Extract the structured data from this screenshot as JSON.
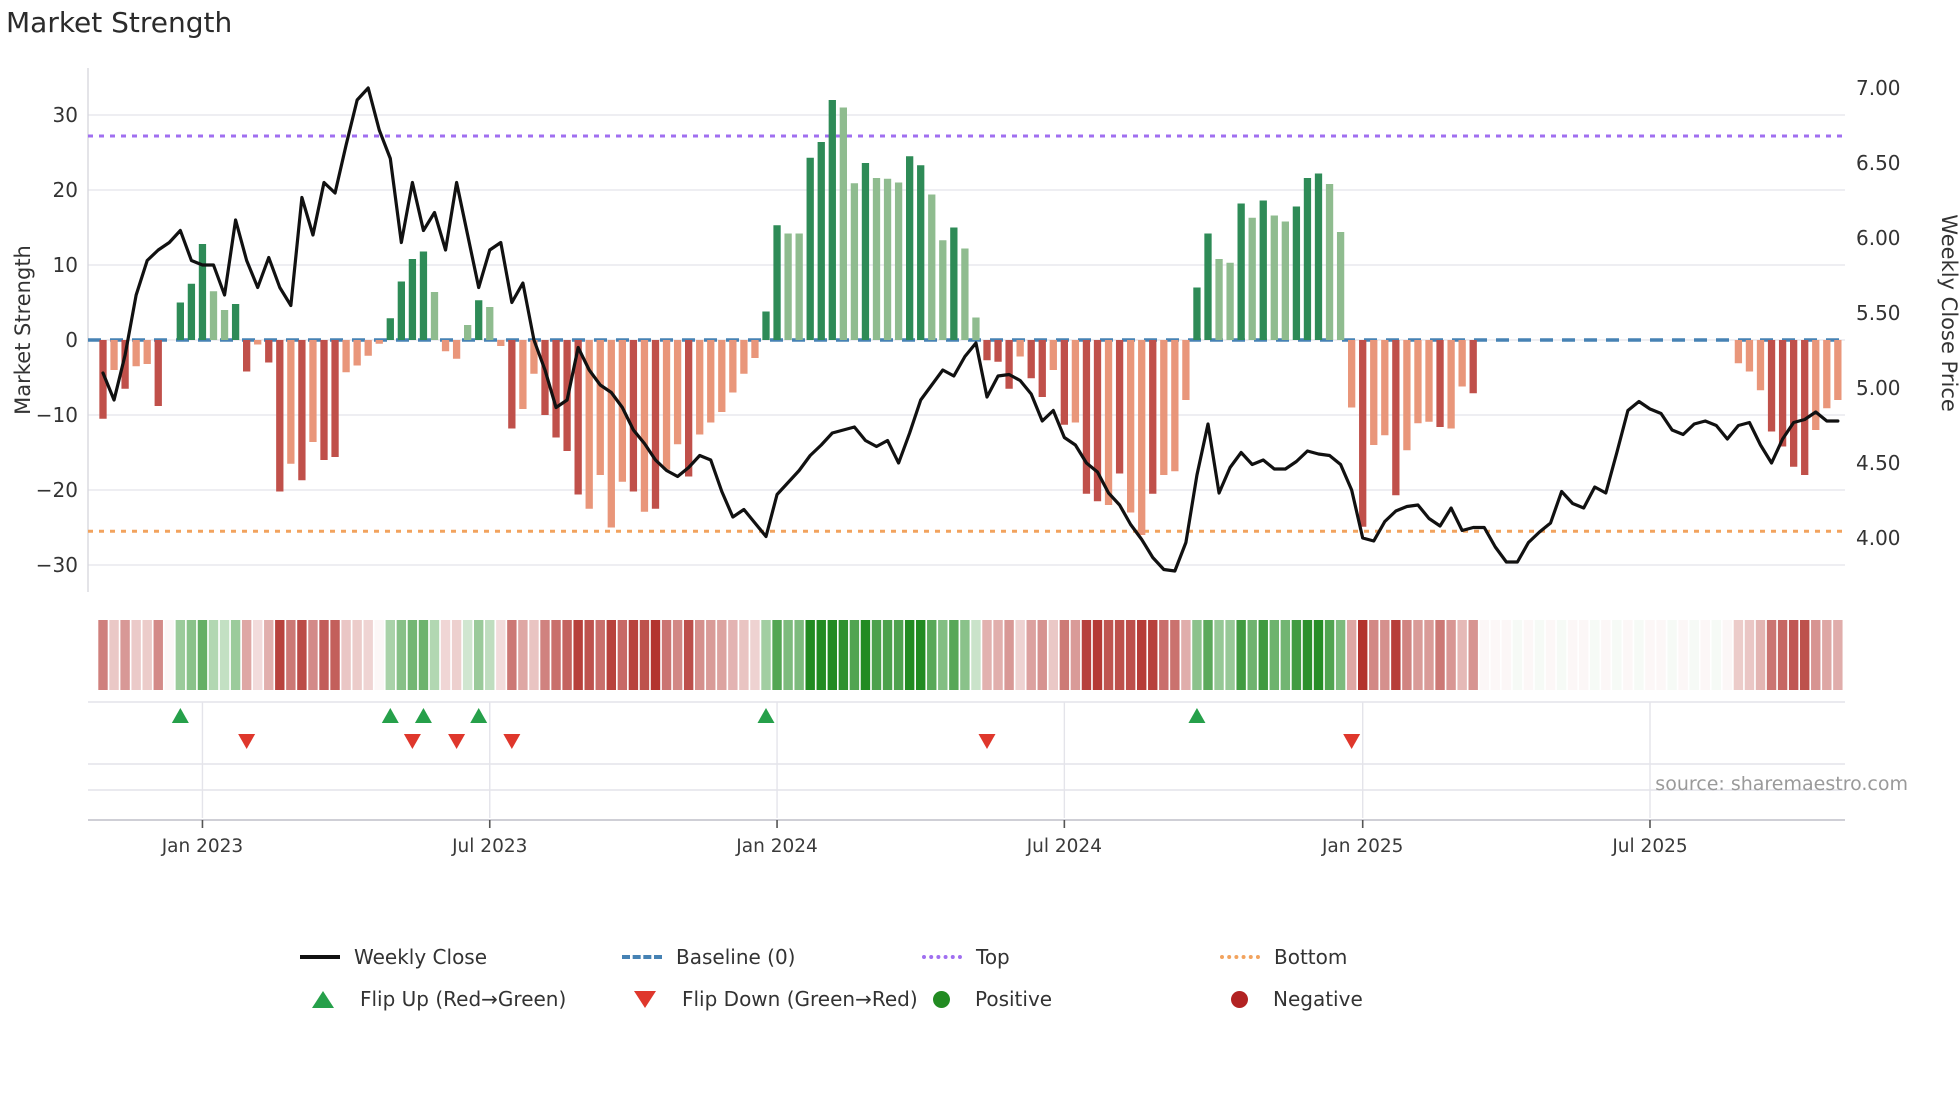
{
  "title": "Market Strength",
  "source": "source: sharemaestro.com",
  "axes": {
    "left_label": "Market Strength",
    "right_label": "Weekly Close Price",
    "left_ticks": [
      "30",
      "20",
      "10",
      "0",
      "−10",
      "−20",
      "−30"
    ],
    "left_tick_values": [
      30,
      20,
      10,
      0,
      -10,
      -20,
      -30
    ],
    "right_ticks": [
      "7.00",
      "6.50",
      "6.00",
      "5.50",
      "5.00",
      "4.50",
      "4.00"
    ],
    "right_tick_values": [
      7.0,
      6.5,
      6.0,
      5.5,
      5.0,
      4.5,
      4.0
    ]
  },
  "legend": {
    "weekly_close": "Weekly Close",
    "baseline": "Baseline (0)",
    "top": "Top",
    "bottom": "Bottom",
    "flip_up": "Flip Up (Red→Green)",
    "flip_down": "Flip Down (Green→Red)",
    "positive": "Positive",
    "negative": "Negative"
  },
  "colors": {
    "line": "#111111",
    "baseline": "#4682b4",
    "top": "#a06ff0",
    "bottom": "#f2a35e",
    "bar_pos_strong": "#2e8b57",
    "bar_pos_soft": "#8fbc8f",
    "bar_neg_strong": "#c0504a",
    "bar_neg_soft": "#e9967a",
    "flip_up": "#26a04a",
    "flip_down": "#df372c",
    "grid": "#e8e8ee"
  },
  "chart_data": {
    "type": "combo-bar-line-heatmap",
    "start_date": "2022-10-31",
    "interval_days": 7,
    "n_weeks": 158,
    "x_ticks": [
      {
        "index": 9,
        "label": "Jan 2023"
      },
      {
        "index": 35,
        "label": "Jul 2023"
      },
      {
        "index": 61,
        "label": "Jan 2024"
      },
      {
        "index": 87,
        "label": "Jul 2024"
      },
      {
        "index": 114,
        "label": "Jan 2025"
      },
      {
        "index": 140,
        "label": "Jul 2025"
      }
    ],
    "y_left_range": [
      -33.6,
      36.3
    ],
    "y_right_range": [
      3.64,
      7.14
    ],
    "reference_lines": {
      "baseline_value": 0,
      "top_value": 27.2,
      "bottom_value": -25.5
    },
    "series": [
      {
        "name": "Market Strength",
        "type": "bar",
        "axis": "left",
        "values": [
          -10.5,
          -4,
          -6.5,
          -3.5,
          -3.2,
          -8.8,
          -0.4,
          5,
          7.5,
          12.8,
          6.5,
          4,
          4.8,
          -4.2,
          -0.6,
          -3,
          -20.2,
          -16.5,
          -18.7,
          -13.6,
          -16,
          -15.6,
          -4.3,
          -3.4,
          -2.1,
          -0.5,
          2.9,
          7.8,
          10.8,
          11.8,
          6.4,
          -1.5,
          -2.5,
          2,
          5.3,
          4.4,
          -0.8,
          -11.8,
          -9.2,
          -4.5,
          -10,
          -13,
          -14.8,
          -20.6,
          -22.5,
          -18,
          -25,
          -18.9,
          -20.2,
          -22.9,
          -22.5,
          -17.3,
          -13.9,
          -18.2,
          -12.6,
          -11,
          -9.6,
          -7,
          -4.5,
          -2.4,
          3.8,
          15.3,
          14.2,
          14.2,
          24.3,
          26.4,
          32,
          31,
          20.9,
          23.6,
          21.6,
          21.5,
          21,
          24.5,
          23.3,
          19.4,
          13.3,
          15,
          12.2,
          3,
          -2.7,
          -2.9,
          -6.5,
          -2.2,
          -5.1,
          -7.6,
          -4,
          -11.3,
          -11,
          -20.5,
          -21.5,
          -22,
          -17.8,
          -23,
          -26,
          -20.5,
          -18,
          -17.5,
          -8,
          7,
          14.2,
          10.8,
          10.3,
          18.2,
          16.3,
          18.6,
          16.6,
          15.8,
          17.8,
          21.6,
          22.2,
          20.8,
          14.4,
          -9,
          -24.9,
          -14,
          -12.7,
          -20.7,
          -14.7,
          -11.1,
          -10.9,
          -11.6,
          -11.8,
          -6.2,
          -7.1,
          -0.4,
          -0.3,
          -0.2,
          0.2,
          -0.3,
          0.3,
          -0.2,
          0.2,
          -0.3,
          -0.2,
          0.2,
          -0.3,
          0.2,
          -0.2,
          0.3,
          -0.2,
          -0.3,
          0.2,
          -0.2,
          0.3,
          -0.3,
          0.2,
          -0.2,
          -3.1,
          -4.2,
          -6.7,
          -12.2,
          -14.2,
          -16.9,
          -18,
          -12,
          -9.1,
          -8
        ],
        "tone": [
          "D",
          "L",
          "D",
          "L",
          "L",
          "D",
          "L",
          "D",
          "D",
          "D",
          "L",
          "L",
          "D",
          "D",
          "L",
          "D",
          "D",
          "L",
          "D",
          "L",
          "D",
          "D",
          "L",
          "L",
          "L",
          "L",
          "D",
          "D",
          "D",
          "D",
          "L",
          "L",
          "L",
          "L",
          "D",
          "L",
          "L",
          "D",
          "L",
          "L",
          "D",
          "D",
          "D",
          "D",
          "L",
          "L",
          "L",
          "L",
          "D",
          "L",
          "D",
          "L",
          "L",
          "D",
          "L",
          "L",
          "L",
          "L",
          "L",
          "L",
          "D",
          "D",
          "L",
          "L",
          "D",
          "D",
          "D",
          "L",
          "L",
          "D",
          "L",
          "L",
          "L",
          "D",
          "D",
          "L",
          "L",
          "D",
          "L",
          "L",
          "D",
          "D",
          "D",
          "L",
          "D",
          "D",
          "L",
          "D",
          "L",
          "D",
          "D",
          "L",
          "D",
          "L",
          "L",
          "D",
          "L",
          "L",
          "L",
          "D",
          "D",
          "L",
          "L",
          "D",
          "L",
          "D",
          "L",
          "L",
          "D",
          "D",
          "D",
          "L",
          "L",
          "L",
          "D",
          "L",
          "L",
          "D",
          "L",
          "L",
          "L",
          "D",
          "L",
          "L",
          "D",
          "L",
          "L",
          "L",
          "L",
          "L",
          "L",
          "L",
          "L",
          "L",
          "L",
          "L",
          "L",
          "L",
          "L",
          "L",
          "L",
          "L",
          "L",
          "L",
          "L",
          "L",
          "L",
          "L",
          "L",
          "L",
          "L",
          "D",
          "D",
          "D",
          "D",
          "L",
          "L",
          "L"
        ]
      },
      {
        "name": "Weekly Close",
        "type": "line",
        "axis": "right",
        "values": [
          5.1,
          4.92,
          5.22,
          5.62,
          5.85,
          5.92,
          5.97,
          6.05,
          5.85,
          5.82,
          5.82,
          5.62,
          6.12,
          5.85,
          5.67,
          5.87,
          5.67,
          5.55,
          6.27,
          6.02,
          6.37,
          6.3,
          6.62,
          6.92,
          7.0,
          6.72,
          6.53,
          5.97,
          6.37,
          6.05,
          6.17,
          5.92,
          6.37,
          6.02,
          5.67,
          5.92,
          5.97,
          5.57,
          5.7,
          5.32,
          5.12,
          4.87,
          4.92,
          5.27,
          5.12,
          5.02,
          4.97,
          4.87,
          4.72,
          4.63,
          4.52,
          4.45,
          4.41,
          4.47,
          4.55,
          4.52,
          4.31,
          4.14,
          4.19,
          4.1,
          4.01,
          4.29,
          4.37,
          4.45,
          4.55,
          4.62,
          4.7,
          4.72,
          4.74,
          4.65,
          4.61,
          4.65,
          4.5,
          4.7,
          4.92,
          5.02,
          5.12,
          5.08,
          5.21,
          5.3,
          4.94,
          5.08,
          5.09,
          5.05,
          4.96,
          4.78,
          4.85,
          4.67,
          4.62,
          4.5,
          4.44,
          4.3,
          4.22,
          4.09,
          3.99,
          3.87,
          3.79,
          3.78,
          3.97,
          4.42,
          4.76,
          4.3,
          4.47,
          4.57,
          4.49,
          4.52,
          4.46,
          4.46,
          4.51,
          4.58,
          4.56,
          4.55,
          4.49,
          4.32,
          4.0,
          3.98,
          4.11,
          4.18,
          4.21,
          4.22,
          4.13,
          4.08,
          4.2,
          4.05,
          4.07,
          4.07,
          3.94,
          3.84,
          3.84,
          3.97,
          4.04,
          4.1,
          4.31,
          4.23,
          4.2,
          4.34,
          4.3,
          4.57,
          4.85,
          4.91,
          4.86,
          4.83,
          4.72,
          4.69,
          4.76,
          4.78,
          4.75,
          4.66,
          4.75,
          4.77,
          4.62,
          4.5,
          4.66,
          4.77,
          4.79,
          4.84,
          4.78,
          4.78
        ]
      }
    ],
    "heatmap": {
      "note": "weekly cells colored by strength sign and magnitude"
    },
    "flip_up_indices": [
      7,
      26,
      29,
      34,
      60,
      99
    ],
    "flip_down_indices": [
      13,
      28,
      32,
      37,
      80,
      113
    ]
  }
}
